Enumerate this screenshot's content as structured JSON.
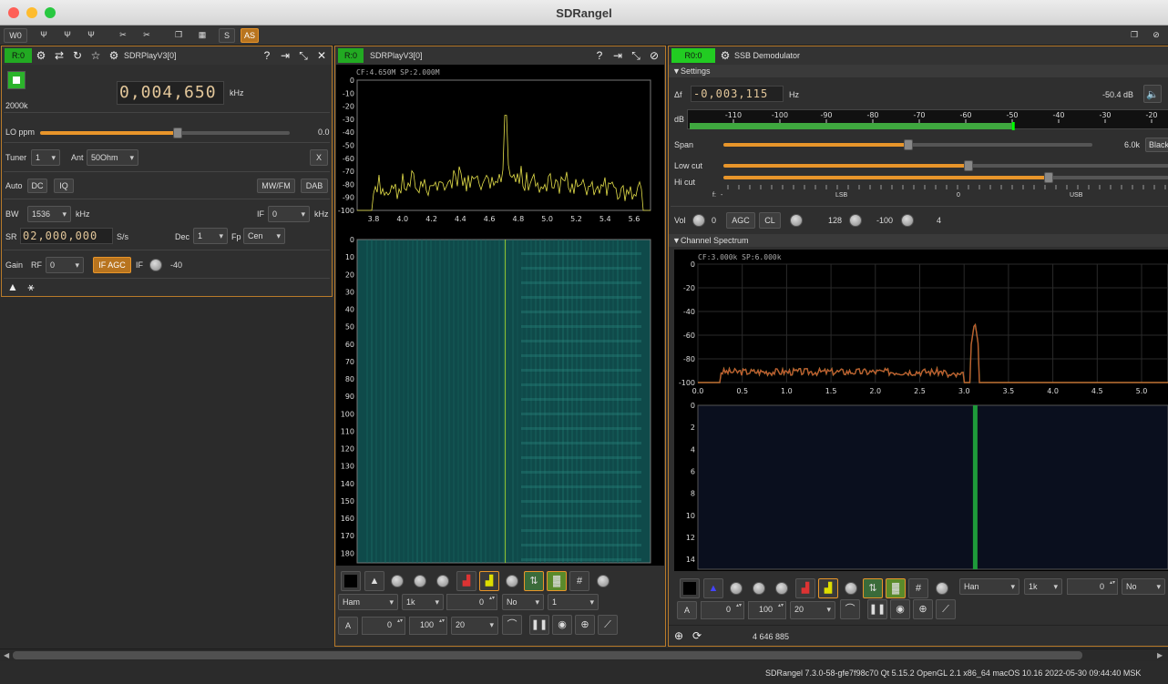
{
  "app": {
    "title": "SDRangel"
  },
  "toolbar": {
    "w0": "W0",
    "s": "S",
    "as": "AS"
  },
  "source": {
    "tag": "R:0",
    "name": "SDRPlayV3[0]",
    "freq": "0,004,650",
    "freq_unit": "kHz",
    "sr_label": "2000k",
    "lo_label": "LO ppm",
    "lo_value": "0.0",
    "lo_fraction": 0.55,
    "tuner_label": "Tuner",
    "tuner_value": "1",
    "ant_label": "Ant",
    "ant_value": "50Ohm",
    "x_btn": "X",
    "auto_label": "Auto",
    "dc": "DC",
    "iq": "IQ",
    "mwfm": "MW/FM",
    "dab": "DAB",
    "bw_label": "BW",
    "bw_value": "1536",
    "bw_unit": "kHz",
    "if_label": "IF",
    "if_value": "0",
    "if_unit": "kHz",
    "sr2_label": "SR",
    "sr2_value": "02,000,000",
    "sr2_unit": "S/s",
    "dec_label": "Dec",
    "dec_value": "1",
    "fp_label": "Fp",
    "fp_value": "Cen",
    "gain_label": "Gain",
    "rf_label": "RF",
    "rf_value": "0",
    "ifagc": "IF AGC",
    "ifg_label": "IF",
    "ifg_value": "-40"
  },
  "spectrum": {
    "tag": "R:0",
    "name": "SDRPlayV3[0]",
    "info": "CF:4.650M SP:2.000M",
    "y_ticks": [
      "0",
      "-10",
      "-20",
      "-30",
      "-40",
      "-50",
      "-60",
      "-70",
      "-80",
      "-90",
      "-100"
    ],
    "x_ticks": [
      "3.8",
      "4.0",
      "4.2",
      "4.4",
      "4.6",
      "4.8",
      "5.0",
      "5.2",
      "5.4",
      "5.6"
    ],
    "wf_ticks": [
      "0",
      "10",
      "20",
      "30",
      "40",
      "50",
      "60",
      "70",
      "80",
      "90",
      "100",
      "110",
      "120",
      "130",
      "140",
      "150",
      "160",
      "170",
      "180"
    ],
    "ctrl": {
      "window": "Ham",
      "fft": "1k",
      "ref": "0",
      "overlap": "No",
      "avg": "1",
      "a": "A",
      "v1": "0",
      "v2": "100",
      "v3": "20"
    }
  },
  "demod": {
    "tag": "R0:0",
    "name": "SSB Demodulator",
    "settings": "Settings",
    "df_label": "Δf",
    "df_value": "-0,003,115",
    "df_unit": "Hz",
    "level": "-50.4 dB",
    "db_label": "dB",
    "meter_ticks": [
      "-110",
      "-100",
      "-90",
      "-80",
      "-70",
      "-60",
      "-50",
      "-40",
      "-30",
      "-20"
    ],
    "meter_fraction": 0.68,
    "span_label": "Span",
    "span_value": "6.0k",
    "span_fraction": 0.5,
    "black": "Black",
    "lowcut_label": "Low cut",
    "lowcut_fraction": 0.55,
    "hicut_label": "Hi cut",
    "hicut_fraction": 0.73,
    "scale_f": "f:",
    "scale_dash": "-",
    "lsb": "LSB",
    "zero": "0",
    "usb": "USB",
    "vol_label": "Vol",
    "vol_value": "0",
    "agc": "AGC",
    "cl": "CL",
    "v128": "128",
    "vm100": "-100",
    "v4": "4",
    "chspec": "Channel Spectrum",
    "ch_info": "CF:3.000k SP:6.000k",
    "ch_y": [
      "0",
      "-20",
      "-40",
      "-60",
      "-80",
      "-100"
    ],
    "ch_x": [
      "0.0",
      "0.5",
      "1.0",
      "1.5",
      "2.0",
      "2.5",
      "3.0",
      "3.5",
      "4.0",
      "4.5",
      "5.0"
    ],
    "ch_wf": [
      "0",
      "2",
      "4",
      "6",
      "8",
      "10",
      "12",
      "14"
    ],
    "ctrl": {
      "window": "Han",
      "fft": "1k",
      "ref": "0",
      "overlap": "No",
      "a": "A",
      "v1": "0",
      "v2": "100",
      "v3": "20"
    },
    "position": "4 646 885"
  },
  "status": {
    "text": "SDRangel 7.3.0-58-gfe7f98c70 Qt 5.15.2 OpenGL 2.1 x86_64 macOS 10.16  2022-05-30 09:44:40 MSK"
  },
  "colors": {
    "accent": "#e8952a",
    "spectrum_trace": "#e5e04a",
    "waterfall": "#0f4a4a",
    "tag_green": "#22aa22"
  }
}
